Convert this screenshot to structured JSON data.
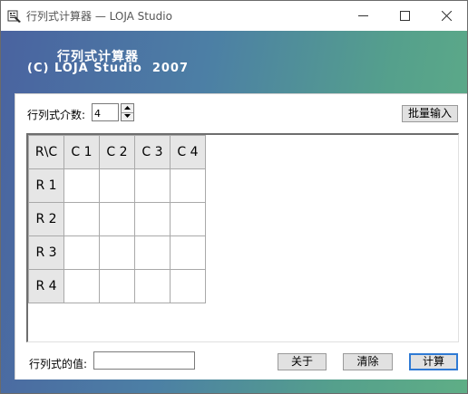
{
  "window": {
    "title": "行列式计算器 — LOJA Studio"
  },
  "header": {
    "title": "行列式计算器",
    "copyright": "(C) LOJA Studio  2007"
  },
  "order": {
    "label": "行列式介数:",
    "value": "4"
  },
  "buttons": {
    "batch": "批量输入",
    "about": "关于",
    "clear": "清除",
    "calc": "计算"
  },
  "matrix": {
    "corner": "R\\C",
    "columns": [
      "C 1",
      "C 2",
      "C 3",
      "C 4"
    ],
    "rows": [
      "R 1",
      "R 2",
      "R 3",
      "R 4"
    ],
    "cells": [
      [
        "",
        "",
        "",
        ""
      ],
      [
        "",
        "",
        "",
        ""
      ],
      [
        "",
        "",
        "",
        ""
      ],
      [
        "",
        "",
        "",
        ""
      ]
    ]
  },
  "result": {
    "label": "行列式的值:",
    "value": ""
  },
  "colors": {
    "gradient_start": "#4a63a0",
    "gradient_end": "#5fae86",
    "default_button_border": "#2f7ad4",
    "header_cell_bg": "#e6e6e6"
  },
  "icons": {
    "app": "app-icon",
    "minimize": "minimize-icon",
    "maximize": "maximize-icon",
    "close": "close-icon",
    "spin_up": "arrow-up-icon",
    "spin_down": "arrow-down-icon"
  }
}
